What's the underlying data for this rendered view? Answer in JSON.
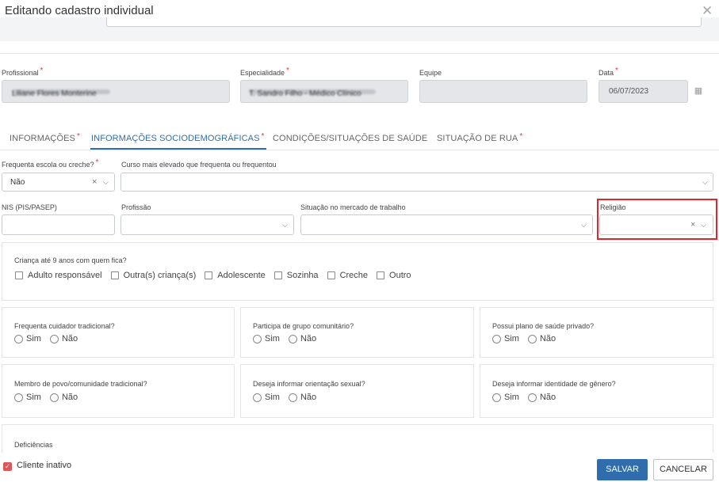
{
  "modal": {
    "title": "Editando cadastro individual"
  },
  "header_fields": {
    "profissional": {
      "label": "Profissional",
      "value": "Liliane Flores Monterine"
    },
    "especialidade": {
      "label": "Especialidade",
      "value": "T. Sandro Filho - Médico Clínico"
    },
    "equipe": {
      "label": "Equipe",
      "value": ""
    },
    "data": {
      "label": "Data",
      "value": "06/07/2023"
    }
  },
  "tabs": [
    {
      "label": "INFORMAÇÕES",
      "required": true,
      "active": false
    },
    {
      "label": "INFORMAÇÕES SOCIODEMOGRÁFICAS",
      "required": true,
      "active": true
    },
    {
      "label": "CONDIÇÕES/SITUAÇÕES DE SAÚDE",
      "required": false,
      "active": false
    },
    {
      "label": "SITUAÇÃO DE RUA",
      "required": true,
      "active": false
    }
  ],
  "form": {
    "escola": {
      "label": "Frequenta escola ou creche?",
      "value": "Não"
    },
    "curso": {
      "label": "Curso mais elevado que frequenta ou frequentou",
      "value": ""
    },
    "nis": {
      "label": "NIS (PIS/PASEP)",
      "value": ""
    },
    "profissao": {
      "label": "Profissão",
      "value": ""
    },
    "mercado": {
      "label": "Situação no mercado de trabalho",
      "value": ""
    },
    "religiao": {
      "label": "Religião",
      "value": ""
    }
  },
  "crianca": {
    "label": "Criança até 9 anos com quem fica?",
    "options": [
      "Adulto responsável",
      "Outra(s) criança(s)",
      "Adolescente",
      "Sozinha",
      "Creche",
      "Outro"
    ]
  },
  "radio_questions": [
    {
      "label": "Frequenta cuidador tradicional?",
      "yes": "Sim",
      "no": "Não"
    },
    {
      "label": "Participa de grupo comunitário?",
      "yes": "Sim",
      "no": "Não"
    },
    {
      "label": "Possui plano de saúde privado?",
      "yes": "Sim",
      "no": "Não"
    },
    {
      "label": "Membro de povo/comunidade tradicional?",
      "yes": "Sim",
      "no": "Não"
    },
    {
      "label": "Deseja informar orientação sexual?",
      "yes": "Sim",
      "no": "Não"
    },
    {
      "label": "Deseja informar identidade de gênero?",
      "yes": "Sim",
      "no": "Não"
    }
  ],
  "deficiencias": {
    "label": "Deficiências"
  },
  "footer": {
    "inactive_label": "Cliente inativo",
    "inactive_checked": true,
    "save_label": "SALVAR",
    "cancel_label": "CANCELAR"
  },
  "icons": {
    "close": "close-icon",
    "calendar": "calendar-icon",
    "dropdown": "chevron-down-icon",
    "clear": "clear-icon",
    "checkbox": "checkbox-icon"
  },
  "colors": {
    "primary": "#2f6dad",
    "required": "#e53935",
    "highlight": "#e3242b",
    "checkbox_checked": "#e05656"
  }
}
